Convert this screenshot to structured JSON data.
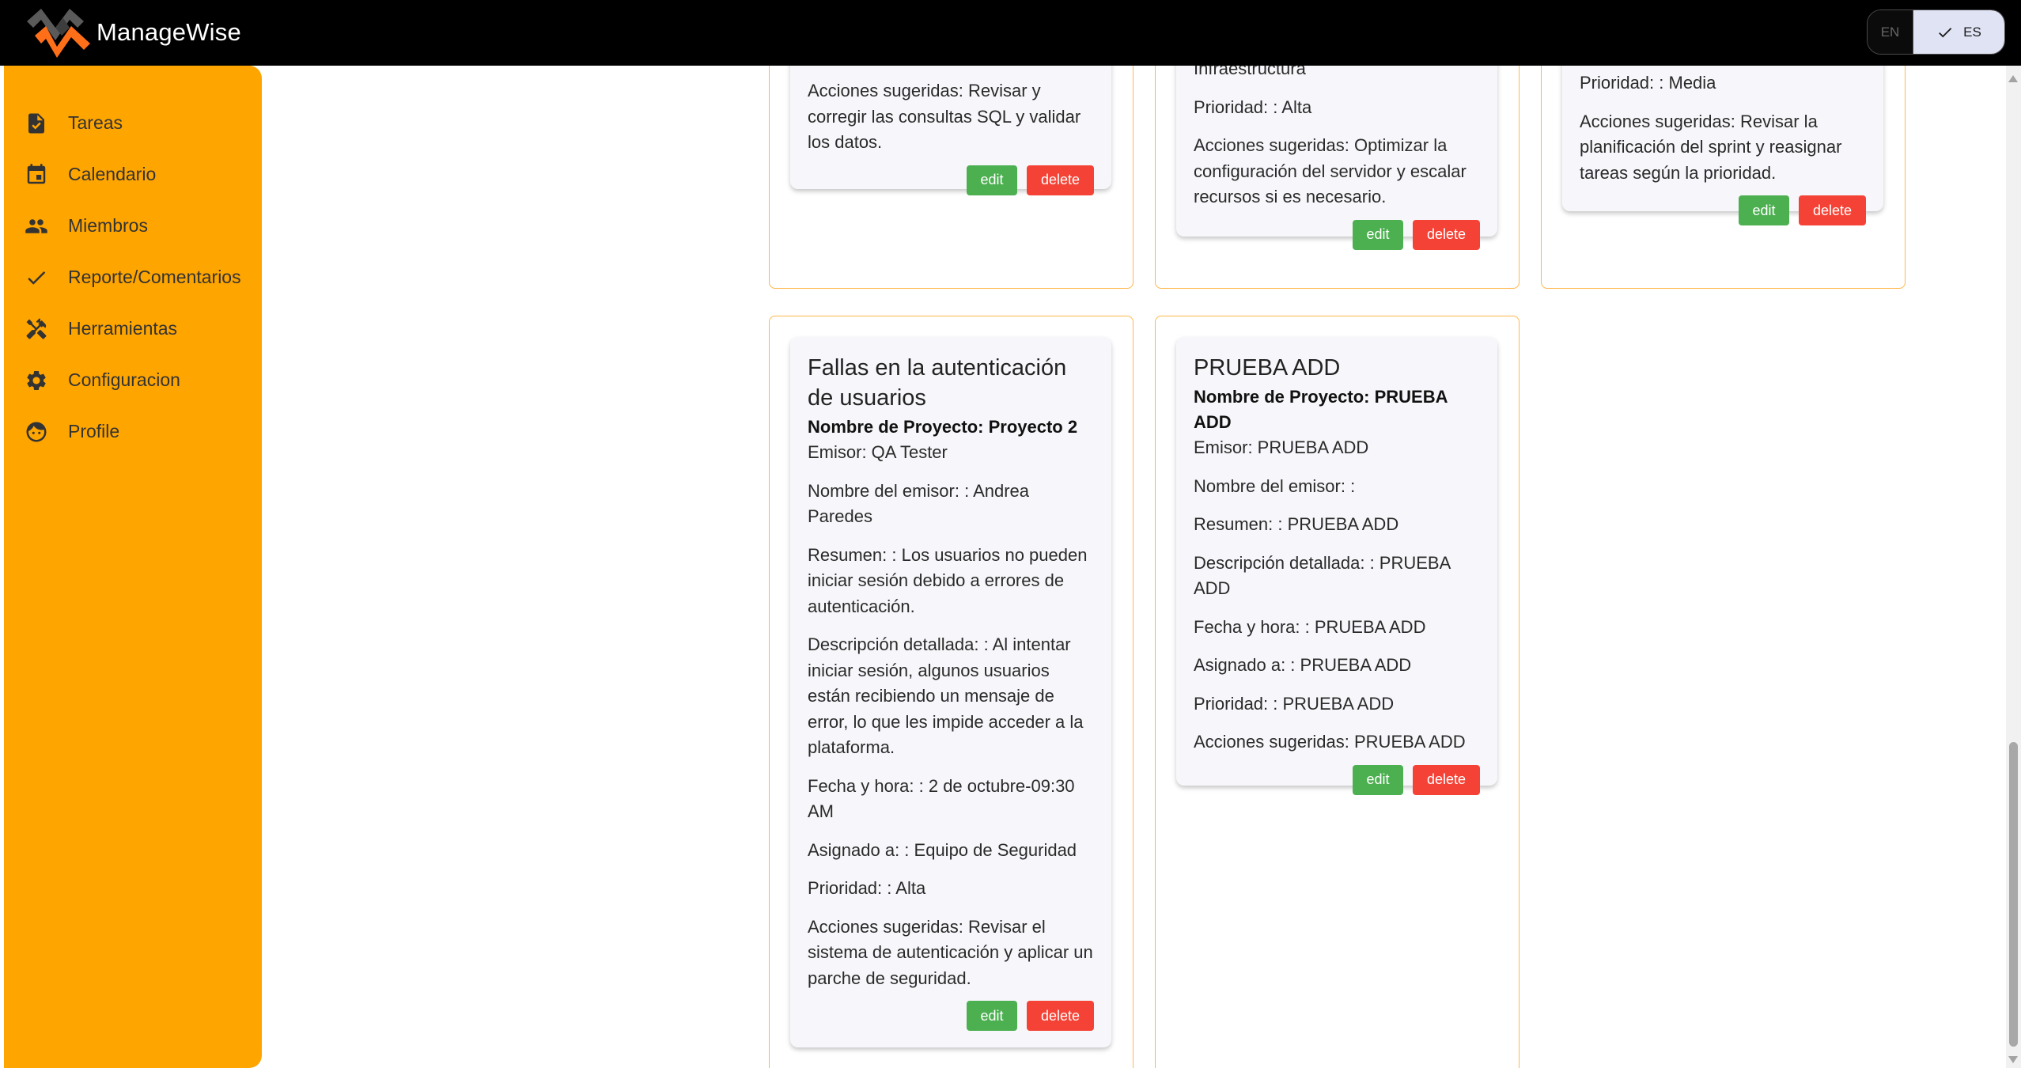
{
  "app": {
    "name": "ManageWise"
  },
  "language": {
    "en_label": "EN",
    "es_label": "ES",
    "selected": "ES"
  },
  "sidebar": {
    "items": [
      {
        "label": "Tareas",
        "icon": "task-icon"
      },
      {
        "label": "Calendario",
        "icon": "calendar-icon"
      },
      {
        "label": "Miembros",
        "icon": "people-icon"
      },
      {
        "label": "Reporte/Comentarios",
        "icon": "check-icon"
      },
      {
        "label": "Herramientas",
        "icon": "tools-icon"
      },
      {
        "label": "Configuracion",
        "icon": "gear-icon"
      },
      {
        "label": "Profile",
        "icon": "face-icon"
      }
    ]
  },
  "cards": {
    "c1": {
      "actions": "Acciones sugeridas: Revisar y corregir las consultas SQL y validar los datos.",
      "edit": "edit",
      "delete": "delete"
    },
    "c2": {
      "assignee_partial": "Infraestructura",
      "priority": "Prioridad: : Alta",
      "actions": "Acciones sugeridas: Optimizar la configuración del servidor y escalar recursos si es necesario.",
      "edit": "edit",
      "delete": "delete"
    },
    "c3": {
      "priority": "Prioridad: : Media",
      "actions": "Acciones sugeridas: Revisar la planificación del sprint y reasignar tareas según la prioridad.",
      "edit": "edit",
      "delete": "delete"
    },
    "c4": {
      "title": "Fallas en la autenticación de usuarios",
      "project": "Nombre de Proyecto: Proyecto 2",
      "emisor": "Emisor: QA Tester",
      "emisor_name": "Nombre del emisor: : Andrea Paredes",
      "summary": "Resumen: : Los usuarios no pueden iniciar sesión debido a errores de autenticación.",
      "description": "Descripción detallada: : Al intentar iniciar sesión, algunos usuarios están recibiendo un mensaje de error, lo que les impide acceder a la plataforma.",
      "datetime": "Fecha y hora: : 2 de octubre-09:30 AM",
      "assignee": "Asignado a: : Equipo de Seguridad",
      "priority": "Prioridad: : Alta",
      "actions": "Acciones sugeridas: Revisar el sistema de autenticación y aplicar un parche de seguridad.",
      "edit": "edit",
      "delete": "delete"
    },
    "c5": {
      "title": "PRUEBA ADD",
      "project": "Nombre de Proyecto: PRUEBA ADD",
      "emisor": "Emisor: PRUEBA ADD",
      "emisor_name": "Nombre del emisor: :",
      "summary": "Resumen: : PRUEBA ADD",
      "description": "Descripción detallada: : PRUEBA ADD",
      "datetime": "Fecha y hora: : PRUEBA ADD",
      "assignee": "Asignado a: : PRUEBA ADD",
      "priority": "Prioridad: : PRUEBA ADD",
      "actions": "Acciones sugeridas: PRUEBA ADD",
      "edit": "edit",
      "delete": "delete"
    }
  },
  "colors": {
    "topbar": "#000000",
    "sidebar": "#ffa500",
    "panel_border": "#ffb74d",
    "edit": "#4caf50",
    "delete": "#f44336"
  }
}
